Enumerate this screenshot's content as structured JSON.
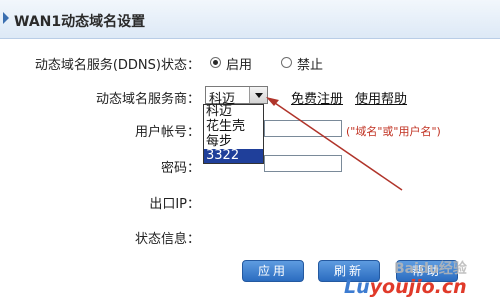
{
  "header": {
    "title": "WAN1动态域名设置"
  },
  "ddns_status": {
    "label": "动态域名服务(DDNS)状态：",
    "enable_label": "启用",
    "disable_label": "禁止",
    "selected": "启用"
  },
  "provider": {
    "label": "动态域名服务商：",
    "selected": "科迈",
    "options": [
      "科迈",
      "花生壳",
      "每步",
      "3322"
    ],
    "highlighted": "3322",
    "register_link": "免费注册",
    "help_link": "使用帮助"
  },
  "username": {
    "label": "用户帐号：",
    "value": "",
    "hint": "(\"域名\"或\"用户名\")"
  },
  "password": {
    "label": "密码：",
    "value": ""
  },
  "wan_ip": {
    "label": "出口IP：",
    "value": ""
  },
  "status_info": {
    "label": "状态信息：",
    "value": ""
  },
  "buttons": {
    "apply": "应用",
    "refresh": "刷新",
    "help": "帮助"
  },
  "watermark": {
    "text": "Baidu经验",
    "url_part1": "Lu",
    "url_part2": "youjio.cn"
  },
  "colors": {
    "accent": "#2b6cc0",
    "hint": "#c03020",
    "annotation_arrow": "#b0342a"
  }
}
